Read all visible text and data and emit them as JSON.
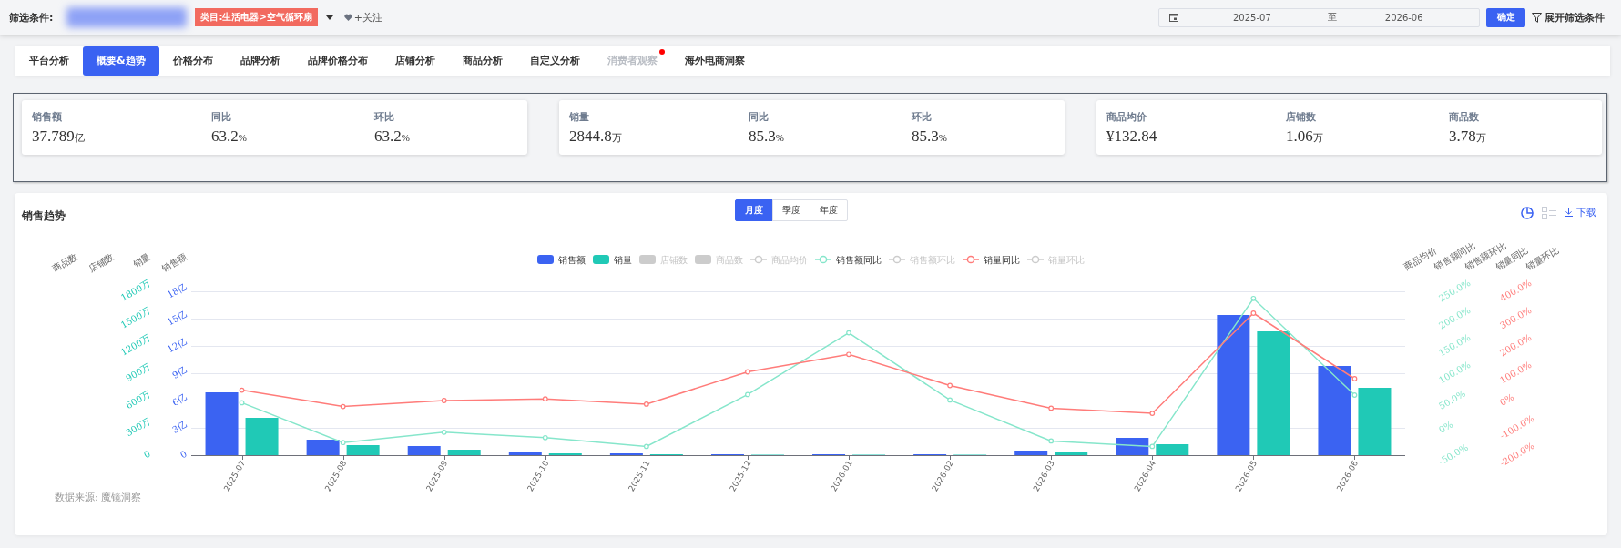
{
  "filter_bar": {
    "label": "筛选条件:",
    "category_tag": "类目:生活电器>空气循环扇",
    "follow": "+关注",
    "date_range": {
      "start": "2025-07",
      "separator": "至",
      "end": "2026-06"
    },
    "confirm": "确定",
    "expand": "展开筛选条件"
  },
  "tabs": [
    {
      "label": "平台分析",
      "selected": false,
      "disabled": false,
      "dot": false
    },
    {
      "label": "概要&趋势",
      "selected": true,
      "disabled": false,
      "dot": false
    },
    {
      "label": "价格分布",
      "selected": false,
      "disabled": false,
      "dot": false
    },
    {
      "label": "品牌分析",
      "selected": false,
      "disabled": false,
      "dot": false
    },
    {
      "label": "品牌价格分布",
      "selected": false,
      "disabled": false,
      "dot": false
    },
    {
      "label": "店铺分析",
      "selected": false,
      "disabled": false,
      "dot": false
    },
    {
      "label": "商品分析",
      "selected": false,
      "disabled": false,
      "dot": false
    },
    {
      "label": "自定义分析",
      "selected": false,
      "disabled": false,
      "dot": false
    },
    {
      "label": "消费者观察",
      "selected": false,
      "disabled": true,
      "dot": true
    },
    {
      "label": "海外电商洞察",
      "selected": false,
      "disabled": false,
      "dot": false
    }
  ],
  "kpi_cards": [
    {
      "metrics": [
        {
          "label": "销售额",
          "value": "37.789",
          "unit": "亿"
        },
        {
          "label": "同比",
          "value": "63.2",
          "unit": "%"
        },
        {
          "label": "环比",
          "value": "63.2",
          "unit": "%"
        }
      ]
    },
    {
      "metrics": [
        {
          "label": "销量",
          "value": "2844.8",
          "unit": "万"
        },
        {
          "label": "同比",
          "value": "85.3",
          "unit": "%"
        },
        {
          "label": "环比",
          "value": "85.3",
          "unit": "%"
        }
      ]
    },
    {
      "metrics": [
        {
          "label": "商品均价",
          "value": "¥132.84"
        },
        {
          "label": "店铺数",
          "value": "1.06",
          "unit": "万"
        },
        {
          "label": "商品数",
          "value": "3.78",
          "unit": "万"
        }
      ]
    }
  ],
  "sales_trend": {
    "title": "销售趋势",
    "periods": [
      {
        "label": "月度",
        "selected": true
      },
      {
        "label": "季度",
        "selected": false
      },
      {
        "label": "年度",
        "selected": false
      }
    ],
    "view_toggle": [
      {
        "kind": "chart",
        "selected": true
      },
      {
        "kind": "table",
        "selected": false
      }
    ],
    "download": "下载",
    "legend": [
      {
        "on": true
      },
      {
        "on": true
      },
      {
        "on": false
      },
      {
        "on": false
      },
      {
        "on": false
      },
      {
        "on": true
      },
      {
        "on": false
      },
      {
        "on": true
      },
      {
        "on": false
      }
    ],
    "empty_axis_titles": {
      "left": [
        "商品数",
        "店铺数"
      ],
      "right": [
        "商品均价",
        "销售额环比",
        "销量环比"
      ]
    },
    "bar_layer": {
      "chart_data": {
        "type": "bar",
        "categories": [
          "2025-07",
          "2025-08",
          "2025-09",
          "2025-10",
          "2025-11",
          "2025-12",
          "2026-01",
          "2026-02",
          "2026-03",
          "2026-04",
          "2026-05",
          "2026-06"
        ],
        "ylabel": "销售额",
        "ylim": [
          0,
          18
        ],
        "yticks": [
          0,
          {
            "value": 3,
            "label": "3亿"
          },
          {
            "value": 6,
            "label": "6亿"
          },
          {
            "value": 9,
            "label": "9亿"
          },
          {
            "value": 12,
            "label": "12亿"
          },
          {
            "value": 15,
            "label": "15亿"
          },
          {
            "value": 18,
            "label": "18亿"
          }
        ],
        "y2label": "销量",
        "y2lim": [
          0,
          1800
        ],
        "y2ticks": [
          0,
          {
            "value": 300,
            "label": "300万"
          },
          {
            "value": 600,
            "label": "600万"
          },
          {
            "value": 900,
            "label": "900万"
          },
          {
            "value": 1200,
            "label": "1200万"
          },
          {
            "value": 1500,
            "label": "1500万"
          },
          {
            "value": 1800,
            "label": "1800万"
          }
        ],
        "grid": true,
        "legend": "top",
        "series": [
          {
            "name": "销售额",
            "color": "#3b63f2",
            "values": [
              6.9,
              1.7,
              1.0,
              0.4,
              0.2,
              0.1,
              0.1,
              0.1,
              0.5,
              1.9,
              15.4,
              9.8
            ]
          },
          {
            "name": "销量",
            "color": "#20c9b6",
            "axis": "y2",
            "values": [
              410,
              110,
              60,
              20,
              10,
              0,
              0,
              0,
              30,
              120,
              1360,
              740
            ]
          },
          {
            "name": "店铺数",
            "values": [
              null,
              null,
              null,
              null,
              null,
              null,
              null,
              null,
              null,
              null,
              null,
              null
            ]
          },
          {
            "name": "商品数",
            "values": [
              null,
              null,
              null,
              null,
              null,
              null,
              null,
              null,
              null,
              null,
              null,
              null
            ]
          }
        ]
      }
    },
    "line_layer": {
      "chart_data": {
        "type": "line",
        "categories": [
          null,
          null,
          null,
          null,
          null,
          null,
          null,
          null,
          null,
          null,
          null,
          null
        ],
        "ylabel": "销售额同比",
        "ylim": [
          -50,
          250
        ],
        "yticks": [
          {
            "value": -50,
            "label": "-50.0%"
          },
          {
            "value": 0,
            "label": "0%"
          },
          {
            "value": 50,
            "label": "50.0%"
          },
          {
            "value": 100,
            "label": "100.0%"
          },
          {
            "value": 150,
            "label": "150.0%"
          },
          {
            "value": 200,
            "label": "200.0%"
          },
          {
            "value": 250,
            "label": "250.0%"
          }
        ],
        "y2label": "销量同比",
        "y2lim": [
          -200,
          400
        ],
        "y2ticks": [
          {
            "value": -200,
            "label": "-200.0%"
          },
          {
            "value": -100,
            "label": "-100.0%"
          },
          {
            "value": 0,
            "label": "0%"
          },
          {
            "value": 100,
            "label": "100.0%"
          },
          {
            "value": 200,
            "label": "200.0%"
          },
          {
            "value": 300,
            "label": "300.0%"
          },
          {
            "value": 400,
            "label": "400.0%"
          }
        ],
        "legend": "top",
        "series": [
          {
            "name": "商品均价",
            "values": [
              null,
              null,
              null,
              null,
              null,
              null,
              null,
              null,
              null,
              null,
              null,
              null
            ]
          },
          {
            "name": "销售额同比",
            "color": "#86e6cb",
            "marker": "circle",
            "values": [
              46,
              -27,
              -8,
              -18,
              -34,
              61,
              174,
              51,
              -24,
              -34,
              237,
              60
            ]
          },
          {
            "name": "销售额环比",
            "values": [
              null,
              null,
              null,
              null,
              null,
              null,
              null,
              null,
              null,
              null,
              null,
              null
            ]
          },
          {
            "name": "销量同比",
            "color": "#ff7c7a",
            "axis": "y2",
            "marker": "circle",
            "values": [
              38,
              -22,
              0,
              6,
              -13,
              105,
              169,
              55,
              -28,
              -47,
              320,
              80
            ]
          },
          {
            "name": "销量环比",
            "values": [
              null,
              null,
              null,
              null,
              null,
              null,
              null,
              null,
              null,
              null,
              null,
              null
            ]
          }
        ]
      }
    },
    "source": "数据来源: 魔镜洞察"
  }
}
